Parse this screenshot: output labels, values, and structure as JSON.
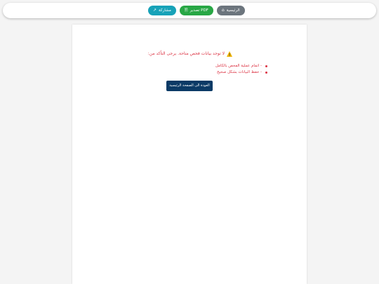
{
  "toolbar": {
    "share": {
      "label": "مشاركة",
      "icon": "share-icon",
      "color": "#17a2b8"
    },
    "pdf": {
      "label": "تصدير PDF",
      "icon": "document-icon",
      "color": "#28a745"
    },
    "home": {
      "label": "الرئيسية",
      "icon": "home-icon",
      "color": "#6c757d"
    }
  },
  "message": {
    "warning_text": "لا توجد بيانات فحص متاحة. يرجى التأكد من:",
    "items": [
      "- اتمام عملية الفحص بالكامل",
      "- حفظ البيانات بشكل صحيح"
    ],
    "color": "#dc3545"
  },
  "actions": {
    "back_label": "العودة الى الصفحة الرئيسية",
    "color": "#0b3a66"
  }
}
